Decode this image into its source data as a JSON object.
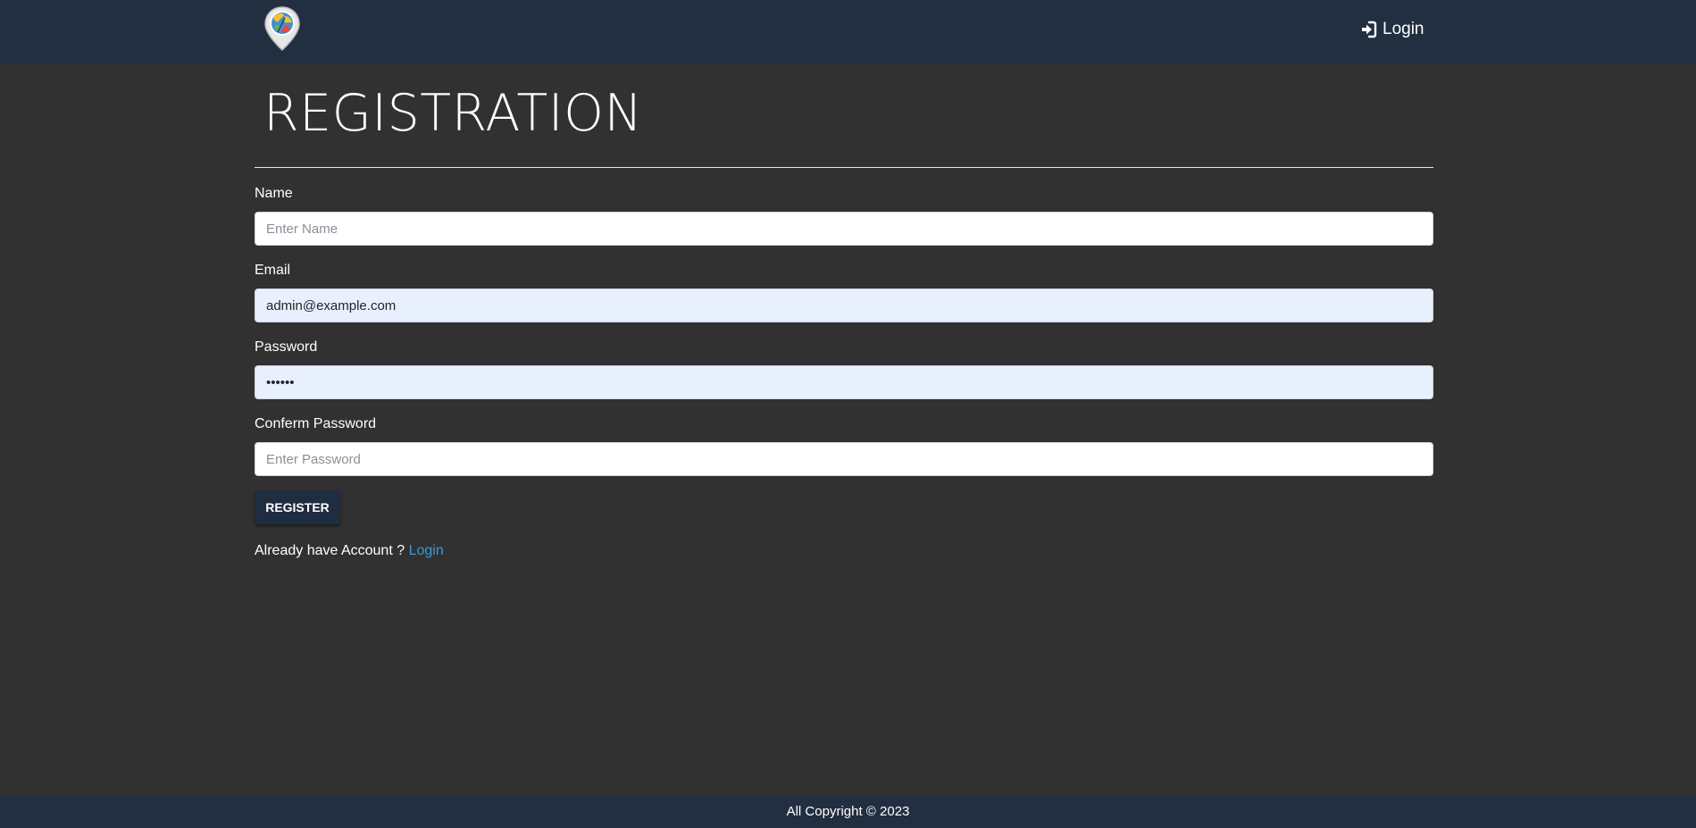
{
  "navbar": {
    "logo_icon": "map-pin-globe-icon",
    "login_icon": "sign-in-icon",
    "login_label": "Login"
  },
  "page": {
    "title": "REGISTRATION"
  },
  "form": {
    "name_label": "Name",
    "name_placeholder": "Enter Name",
    "name_value": "",
    "email_label": "Email",
    "email_value": "admin@example.com",
    "password_label": "Password",
    "password_value": "123456",
    "confirm_label": "Conferm Password",
    "confirm_placeholder": "Enter Password",
    "confirm_value": "",
    "register_label": "REGISTER",
    "already_text": "Already have Account ?",
    "login_link": "Login"
  },
  "footer": {
    "text": "All Copyright © 2023"
  },
  "colors": {
    "navbar_bg": "#212f41",
    "page_bg": "#313131",
    "autofill_bg": "#e8f0fe",
    "link": "#3e96d6"
  }
}
